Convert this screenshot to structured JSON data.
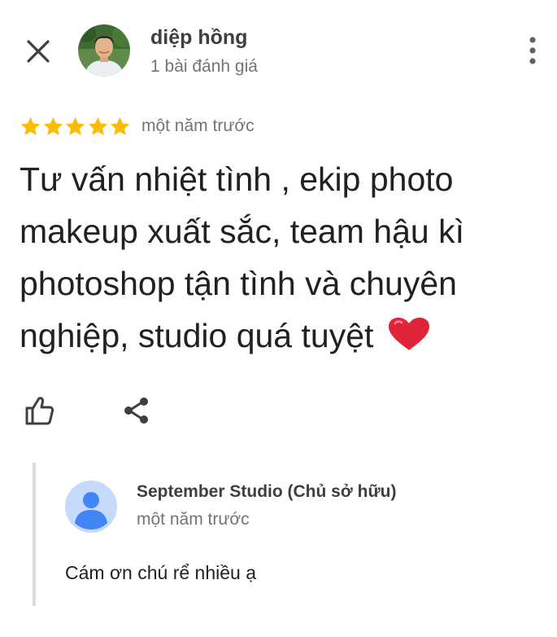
{
  "header": {
    "close_icon": "close-icon",
    "more_icon": "more-vertical-icon"
  },
  "reviewer": {
    "name": "diệp hồng",
    "review_count": "1 bài đánh giá",
    "avatar": "user-photo"
  },
  "review": {
    "rating": 5,
    "max_rating": 5,
    "star_color": "#fbbc04",
    "date": "một năm trước",
    "text": "Tư vấn nhiệt tình , ekip photo makeup xuất sắc, team hậu kì photoshop tận tình và chuyên nghiệp, studio quá tuyệt",
    "emoji": "heart-emoji",
    "heart_color": "#e0243a"
  },
  "actions": {
    "like_icon": "thumbs-up-icon",
    "share_icon": "share-icon"
  },
  "owner_reply": {
    "name": "September Studio (Chủ sở hữu)",
    "date": "một năm trước",
    "text": "Cám ơn chú rể nhiều ạ",
    "avatar": "default-avatar-icon",
    "avatar_bg": "#c6dafc",
    "avatar_fg": "#4285f4"
  },
  "colors": {
    "text_primary": "#202124",
    "text_secondary": "#70757a",
    "divider": "#dadce0"
  }
}
